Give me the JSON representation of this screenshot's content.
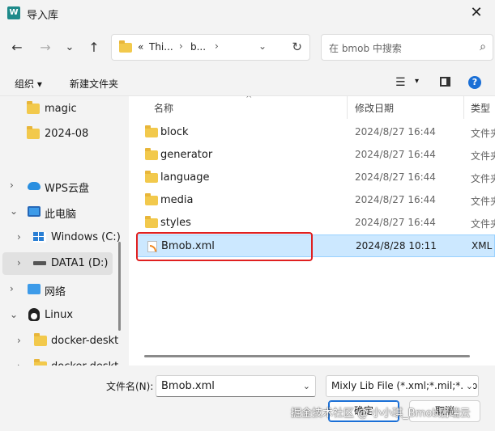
{
  "window": {
    "title": "导入库",
    "app_icon_glyph": "W",
    "close_glyph": "✕"
  },
  "nav": {
    "back_glyph": "←",
    "forward_glyph": "→",
    "recent_glyph": "⌄",
    "up_glyph": "↑",
    "address": {
      "overflow": "«",
      "crumbs": [
        "Thi...",
        "b..."
      ],
      "chevron_glyph": "›",
      "dropdown_glyph": "⌄",
      "refresh_glyph": "↻"
    },
    "search_placeholder": "在 bmob 中搜索",
    "search_glyph": "⌕"
  },
  "toolbar": {
    "organize": "组织 ▾",
    "new_folder": "新建文件夹",
    "view_glyph": "☰",
    "view_arrow": "▾",
    "help_glyph": "?"
  },
  "sidebar": {
    "items": [
      {
        "label": "magic",
        "expander": "",
        "icon": "folder-icon"
      },
      {
        "label": "2024-08",
        "expander": "",
        "icon": "folder-icon"
      },
      {
        "label": "WPS云盘",
        "expander": "›",
        "icon": "cloud-icon"
      },
      {
        "label": "此电脑",
        "expander": "⌄",
        "icon": "computer-icon"
      },
      {
        "label": "Windows (C:)",
        "expander": "›",
        "icon": "windows-drive-icon"
      },
      {
        "label": "DATA1 (D:)",
        "expander": "›",
        "icon": "drive-icon",
        "selected": true
      },
      {
        "label": "网络",
        "expander": "›",
        "icon": "network-icon"
      },
      {
        "label": "Linux",
        "expander": "⌄",
        "icon": "linux-icon"
      },
      {
        "label": "docker-deskt",
        "expander": "›",
        "icon": "folder-icon"
      },
      {
        "label": "docker-deskt",
        "expander": "›",
        "icon": "folder-icon"
      }
    ]
  },
  "columns": {
    "name": "名称",
    "date": "修改日期",
    "type": "类型",
    "sort_glyph": "^"
  },
  "files": [
    {
      "name": "block",
      "date": "2024/8/27 16:44",
      "type": "文件夹",
      "icon": "folder-icon"
    },
    {
      "name": "generator",
      "date": "2024/8/27 16:44",
      "type": "文件夹",
      "icon": "folder-icon"
    },
    {
      "name": "language",
      "date": "2024/8/27 16:44",
      "type": "文件夹",
      "icon": "folder-icon"
    },
    {
      "name": "media",
      "date": "2024/8/27 16:44",
      "type": "文件夹",
      "icon": "folder-icon"
    },
    {
      "name": "styles",
      "date": "2024/8/27 16:44",
      "type": "文件夹",
      "icon": "folder-icon"
    },
    {
      "name": "Bmob.xml",
      "date": "2024/8/28 10:11",
      "type": "XML",
      "icon": "xml-file-icon",
      "selected": true
    }
  ],
  "bottom": {
    "filename_label": "文件名(N):",
    "filename_value": "Bmob.xml",
    "filetype_value": "Mixly Lib File (*.xml;*.mil;*.zip)",
    "open_label": "确定",
    "cancel_label": "取消",
    "dropdown_glyph": "⌄"
  },
  "watermark": "掘金技术社区 @ 小小琪_Bmob后端云",
  "colors": {
    "accent": "#1a6fd6",
    "selection": "#cce8ff",
    "highlight_box": "#e02020",
    "folder": "#f2c94c"
  }
}
